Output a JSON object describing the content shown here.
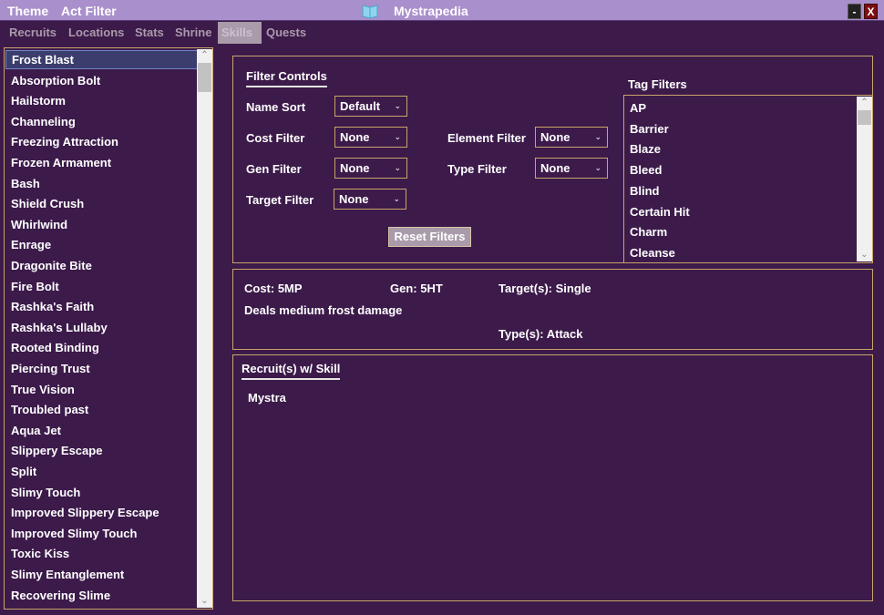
{
  "titlebar": {
    "menu": [
      "Theme",
      "Act Filter"
    ],
    "title": "Mystrapedia",
    "minimize_label": "-",
    "close_label": "X"
  },
  "tabs": [
    "Recruits",
    "Locations",
    "Stats",
    "Shrine",
    "Skills",
    "Quests"
  ],
  "active_tab": "Skills",
  "skills": [
    "Frost Blast",
    "Absorption Bolt",
    "Hailstorm",
    "Channeling",
    "Freezing Attraction",
    "Frozen Armament",
    "Bash",
    "Shield Crush",
    "Whirlwind",
    "Enrage",
    "Dragonite Bite",
    "Fire Bolt",
    "Rashka's Faith",
    "Rashka's Lullaby",
    "Rooted Binding",
    "Piercing Trust",
    "True Vision",
    "Troubled past",
    "Aqua Jet",
    "Slippery Escape",
    "Split",
    "Slimy Touch",
    "Improved Slippery Escape",
    "Improved Slimy Touch",
    "Toxic Kiss",
    "Slimy Entanglement",
    "Recovering Slime"
  ],
  "selected_skill": "Frost Blast",
  "filters": {
    "heading": "Filter Controls",
    "name_sort": {
      "label": "Name Sort",
      "value": "Default"
    },
    "cost_filter": {
      "label": "Cost Filter",
      "value": "None"
    },
    "gen_filter": {
      "label": "Gen Filter",
      "value": "None"
    },
    "target_filter": {
      "label": "Target Filter",
      "value": "None"
    },
    "element_filter": {
      "label": "Element Filter",
      "value": "None"
    },
    "type_filter": {
      "label": "Type Filter",
      "value": "None"
    },
    "reset_label": "Reset Filters"
  },
  "tag_filters": {
    "heading": "Tag Filters",
    "items": [
      "AP",
      "Barrier",
      "Blaze",
      "Bleed",
      "Blind",
      "Certain Hit",
      "Charm",
      "Cleanse"
    ]
  },
  "skill_info": {
    "cost": "Cost: 5MP",
    "gen": "Gen: 5HT",
    "targets": "Target(s): Single",
    "description": "Deals medium frost damage",
    "types": "Type(s): Attack"
  },
  "recruits": {
    "heading": "Recruit(s) w/ Skill",
    "items": [
      "Mystra"
    ]
  },
  "colors": {
    "background": "#3c1a4a",
    "titlebar": "#a98fcc",
    "border": "#c9a56b",
    "selection": "#3b3e6d",
    "active_tab": "#a99baa"
  }
}
